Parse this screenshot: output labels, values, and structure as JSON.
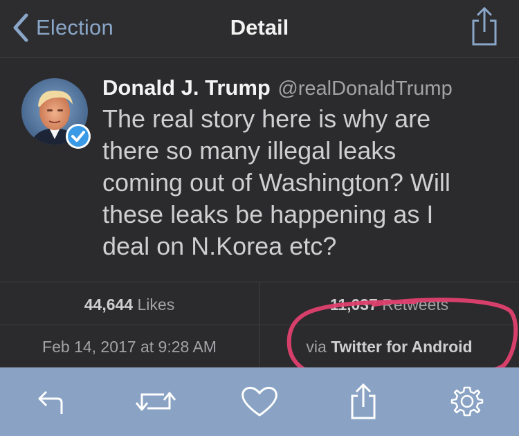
{
  "nav": {
    "back_label": "Election",
    "title": "Detail"
  },
  "tweet": {
    "author_name": "Donald J. Trump",
    "author_handle": "@realDonaldTrump",
    "text": "The real story here is why are\nthere so many illegal leaks\ncoming out of Washington? Will\nthese leaks be happening as I\ndeal on N.Korea etc?",
    "verified": true
  },
  "stats": {
    "likes_count": "44,644",
    "likes_label": "Likes",
    "retweets_count": "11,037",
    "retweets_label": "Retweets",
    "timestamp": "Feb 14, 2017 at 9:28 AM",
    "source_prefix": "via",
    "source_name": "Twitter for Android"
  },
  "toolbar": {
    "icons": [
      "reply-icon",
      "retweet-icon",
      "like-icon",
      "share-icon",
      "settings-icon"
    ]
  },
  "colors": {
    "accent": "#8aa6c8",
    "toolbar": "#8aa3c4",
    "background": "#2b2b2d",
    "annotation": "#e0406f",
    "verified": "#3b9ae6"
  }
}
